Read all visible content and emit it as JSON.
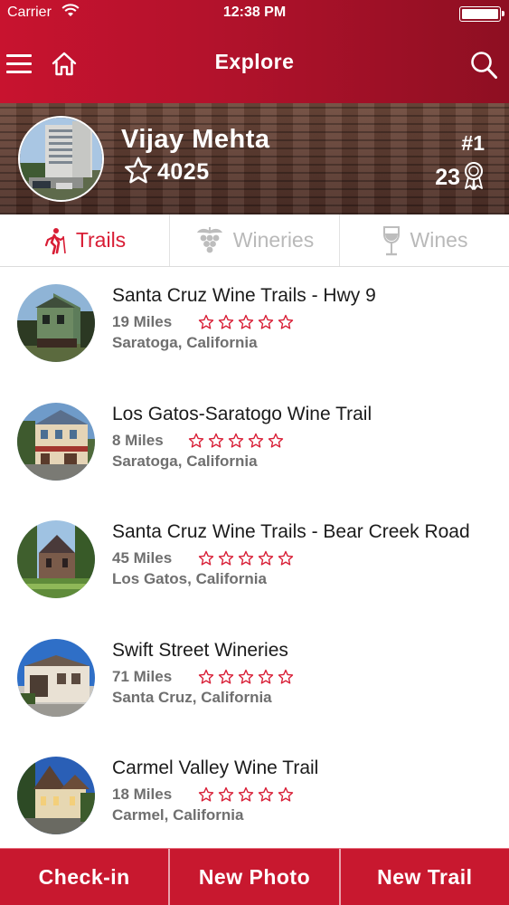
{
  "status_bar": {
    "carrier": "Carrier",
    "time": "12:38 PM"
  },
  "nav": {
    "title": "Explore"
  },
  "profile": {
    "name": "Vijay Mehta",
    "points": "4025",
    "rank": "#1",
    "badges": "23"
  },
  "tabs": [
    {
      "label": "Trails",
      "icon": "hiker-icon",
      "active": true
    },
    {
      "label": "Wineries",
      "icon": "grapes-icon",
      "active": false
    },
    {
      "label": "Wines",
      "icon": "wine-glass-icon",
      "active": false
    }
  ],
  "trails": [
    {
      "name": "Santa Cruz Wine Trails - Hwy 9",
      "miles": "19 Miles",
      "location": "Saratoga, California",
      "rating": 0
    },
    {
      "name": "Los Gatos-Saratogo Wine Trail",
      "miles": "8 Miles",
      "location": "Saratoga, California",
      "rating": 0
    },
    {
      "name": "Santa Cruz Wine Trails - Bear Creek Road",
      "miles": "45 Miles",
      "location": "Los Gatos, California",
      "rating": 0
    },
    {
      "name": "Swift Street Wineries",
      "miles": "71 Miles",
      "location": "Santa Cruz, California",
      "rating": 0
    },
    {
      "name": "Carmel Valley Wine Trail",
      "miles": "18 Miles",
      "location": "Carmel, California",
      "rating": 0
    }
  ],
  "bottom_bar": {
    "checkin": "Check-in",
    "new_photo": "New Photo",
    "new_trail": "New Trail"
  },
  "colors": {
    "brand_red": "#c8132f",
    "active_tab": "#d81d35",
    "star_red": "#d81d35",
    "muted_text": "#6f6f6f"
  }
}
